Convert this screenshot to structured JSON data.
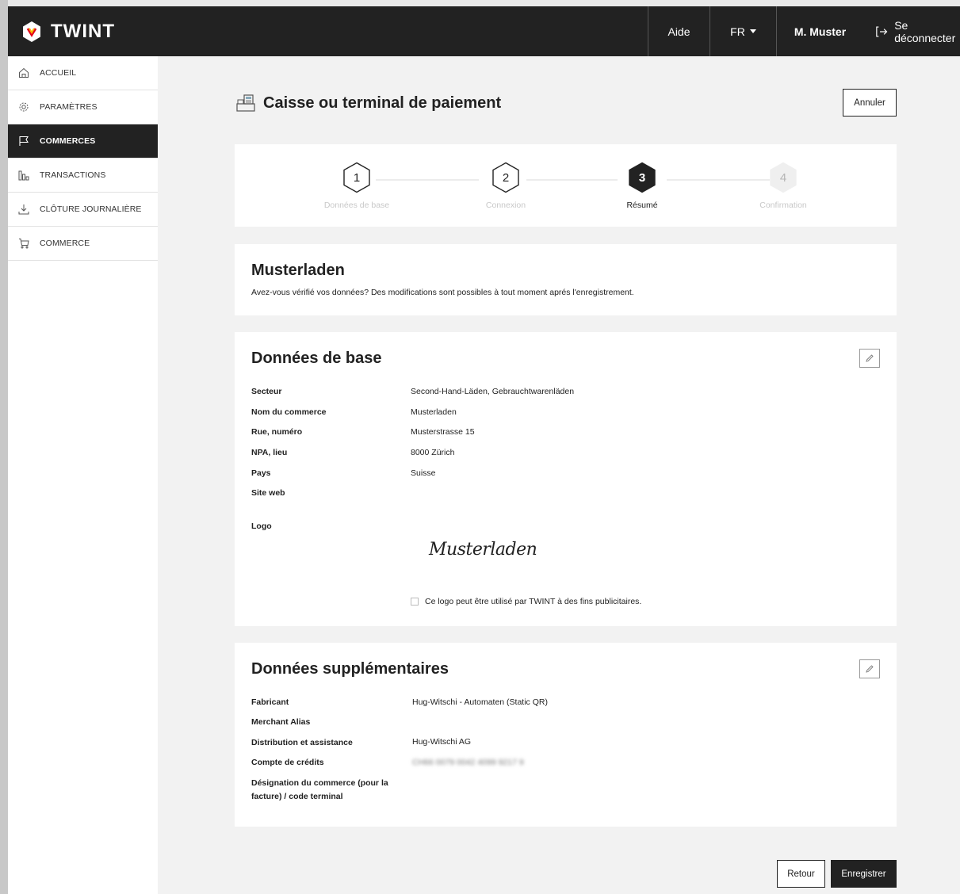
{
  "app": {
    "brand": "TWINT"
  },
  "topbar": {
    "help": "Aide",
    "language": "FR",
    "user": "M. Muster",
    "logout": "Se déconnecter"
  },
  "sidebar": {
    "items": [
      {
        "label": "ACCUEIL",
        "icon": "home-icon",
        "active": false
      },
      {
        "label": "PARAMÈTRES",
        "icon": "gear-icon",
        "active": false
      },
      {
        "label": "COMMERCES",
        "icon": "flag-icon",
        "active": true
      },
      {
        "label": "TRANSACTIONS",
        "icon": "bar-chart-icon",
        "active": false
      },
      {
        "label": "CLÔTURE JOURNALIÈRE",
        "icon": "download-icon",
        "active": false
      },
      {
        "label": "COMMERCE",
        "icon": "cart-icon",
        "active": false
      }
    ]
  },
  "page": {
    "title": "Caisse ou terminal de paiement",
    "cancel": "Annuler"
  },
  "stepper": {
    "steps": [
      {
        "number": "1",
        "label": "Données de base",
        "state": "done"
      },
      {
        "number": "2",
        "label": "Connexion",
        "state": "done"
      },
      {
        "number": "3",
        "label": "Résumé",
        "state": "active"
      },
      {
        "number": "4",
        "label": "Confirmation",
        "state": "pending"
      }
    ]
  },
  "intro": {
    "heading": "Musterladen",
    "text": "Avez-vous vérifié vos données? Des modifications sont possibles à  tout moment aprés l'enregistrement."
  },
  "base_data": {
    "heading": "Données de base",
    "rows": [
      {
        "label": "Secteur",
        "value": "Second-Hand-Läden, Gebrauchtwarenläden"
      },
      {
        "label": "Nom du commerce",
        "value": "Musterladen"
      },
      {
        "label": "Rue, numéro",
        "value": "Musterstrasse 15"
      },
      {
        "label": "NPA, lieu",
        "value": "8000 Zürich"
      },
      {
        "label": "Pays",
        "value": "Suisse"
      },
      {
        "label": "Site web",
        "value": ""
      }
    ],
    "logo_label": "Logo",
    "logo_text": "Musterladen",
    "consent": "Ce logo peut être utilisé par TWINT à  des fins publicitaires."
  },
  "extra_data": {
    "heading": "Données supplémentaires",
    "rows": [
      {
        "label": "Fabricant",
        "value": "Hug-Witschi - Automaten (Static QR)"
      },
      {
        "label": "Merchant Alias",
        "value": ""
      },
      {
        "label": "Distribution et assistance",
        "value": "Hug-Witschi AG"
      },
      {
        "label": "Compte de crédits",
        "value": "CH66 0079 0042 4099 9217 9"
      }
    ],
    "last_label": "Désignation du commerce (pour la facture) / code terminal"
  },
  "actions": {
    "back": "Retour",
    "save": "Enregistrer"
  },
  "colors": {
    "dark": "#222222",
    "brand_accent": "#e2001a"
  }
}
